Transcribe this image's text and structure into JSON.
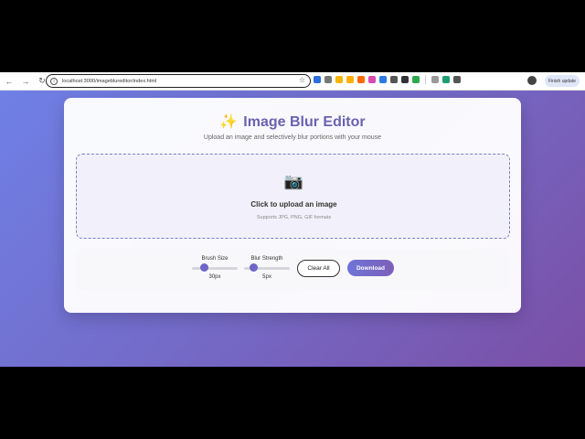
{
  "browser": {
    "url": "localhost:3000/imageblureditor/index.html",
    "finish_update": "Finish update",
    "extension_colors": [
      "#2a6fdb",
      "#777777",
      "#f2b705",
      "#ffb000",
      "#ff6a00",
      "#d84bb0",
      "#2a7ae2",
      "#555555",
      "#333333",
      "#2fa84f",
      "#999999",
      "#1e9e6e",
      "#555555"
    ]
  },
  "app": {
    "title": "Image Blur Editor",
    "subtitle": "Upload an image and selectively blur portions with your mouse",
    "upload": {
      "label": "Click to upload an image",
      "hint": "Supports JPG, PNG, GIF formats"
    },
    "controls": {
      "brush_size": {
        "label": "Brush Size",
        "value_text": "30px",
        "value": 30,
        "min": 5,
        "max": 100
      },
      "blur_strength": {
        "label": "Blur Strength",
        "value_text": "5px",
        "value": 5,
        "min": 1,
        "max": 20
      },
      "clear_label": "Clear All",
      "download_label": "Download"
    },
    "colors": {
      "accent": "#6e65c8",
      "title": "#6a62b0"
    }
  }
}
